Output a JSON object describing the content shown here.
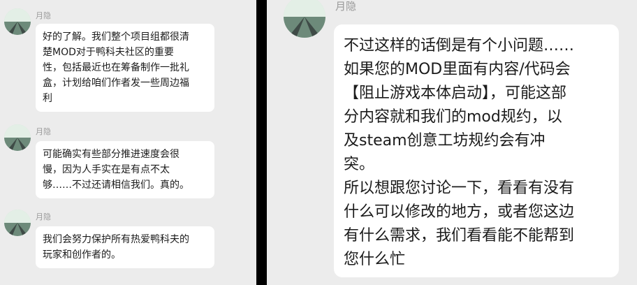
{
  "left_chat": {
    "messages": [
      {
        "sender": "月隐",
        "lines": [
          "好的了解。我们整个项目组都很清",
          "楚MOD对于鸭科夫社区的重要",
          "性，包括最近也在筹备制作一批礼",
          "盒，计划给咱们作者发一些周边福",
          "利"
        ]
      },
      {
        "sender": "月隐",
        "lines": [
          "可能确实有些部分推进速度会很",
          "慢，因为人手实在是有点不太",
          "够……不过还请相信我们。真的。"
        ]
      },
      {
        "sender": "月隐",
        "lines": [
          "我们会努力保护所有热爱鸭科夫的",
          "玩家和创作者的。"
        ]
      }
    ]
  },
  "right_chat": {
    "message": {
      "sender": "月隐",
      "lines": [
        "不过这样的话倒是有个小问题……",
        "如果您的MOD里面有内容/代码会",
        "【阻止游戏本体启动】，可能这部",
        "分内容就和我们的mod规约，以",
        "及steam创意工坊规约会有冲",
        "突。",
        "所以想跟您讨论一下，看看有没有",
        "什么可以修改的地方，或者您这边",
        "有什么需求，我们看看能不能帮到",
        "您什么忙"
      ]
    }
  }
}
